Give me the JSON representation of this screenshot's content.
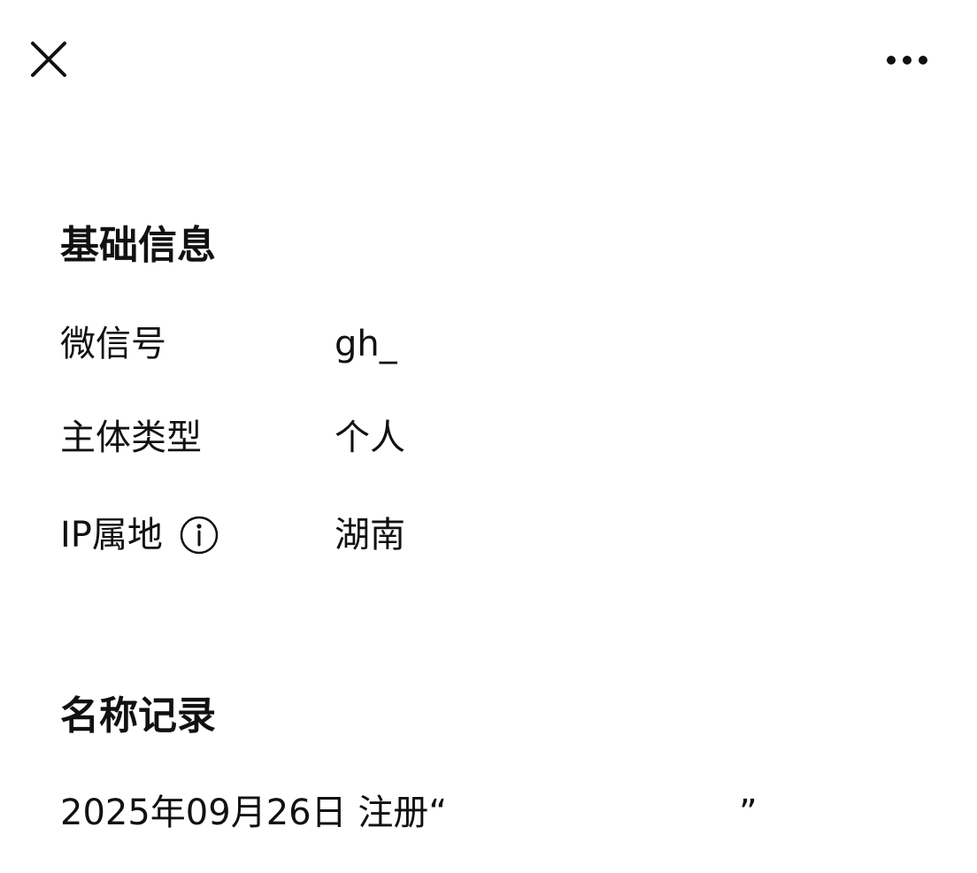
{
  "header": {
    "close_icon": "close-icon",
    "more_icon": "more-icon"
  },
  "basic_info": {
    "title": "基础信息",
    "rows": [
      {
        "label": "微信号",
        "value": "gh_"
      },
      {
        "label": "主体类型",
        "value": "个人"
      },
      {
        "label": "IP属地",
        "value": "湖南",
        "icon": "info-icon"
      }
    ]
  },
  "name_records": {
    "title": "名称记录",
    "items": [
      {
        "date": "2025年09月26日",
        "action": "注册",
        "open_quote": "“",
        "close_quote": "”"
      }
    ]
  }
}
